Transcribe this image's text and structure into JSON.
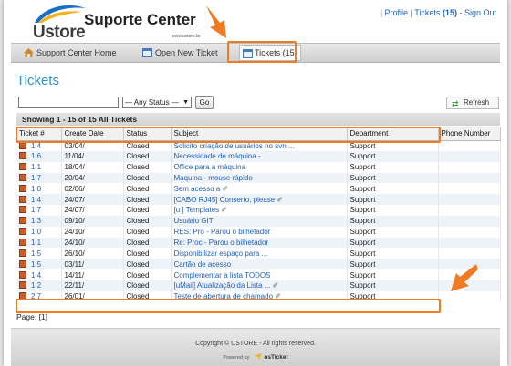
{
  "header": {
    "logo_text": "Ustore",
    "site_title": "Suporte Center",
    "site_url": "www.ustore.br",
    "links": {
      "sep1": "|",
      "profile": "Profile",
      "sep2": "|",
      "tickets_prefix": "Tickets ",
      "tickets_count": "(15)",
      "sep3": " - ",
      "sign_out": "Sign Out"
    }
  },
  "nav": {
    "items": [
      {
        "label": "Support Center Home",
        "icon": "home-icon"
      },
      {
        "label": "Open New Ticket",
        "icon": "new-ticket-icon"
      },
      {
        "label": "Tickets (15)",
        "icon": "tickets-icon",
        "active": true
      }
    ]
  },
  "main": {
    "title": "Tickets",
    "search": {
      "value": "",
      "placeholder": ""
    },
    "status_select": {
      "selected": "— Any Status —",
      "arrow": "▼"
    },
    "go_label": "Go",
    "refresh_label": "Refresh",
    "showing": "Showing  1 - 15 of 15 All Tickets",
    "columns": [
      "Ticket #",
      "Create Date",
      "Status",
      "Subject",
      "Department",
      "Phone Number"
    ],
    "rows": [
      {
        "num": "1   4",
        "date": "03/04/",
        "status": "Closed",
        "subject": "Solicito criação de usuários no svn ...",
        "dept": "Support",
        "attach": false
      },
      {
        "num": "1   6",
        "date": "11/04/",
        "status": "Closed",
        "subject": "Necessidade de máquina -",
        "dept": "Support",
        "attach": false
      },
      {
        "num": "1   1",
        "date": "18/04/",
        "status": "Closed",
        "subject": "Office para a máquina",
        "dept": "Support",
        "attach": false
      },
      {
        "num": "1   7",
        "date": "20/04/",
        "status": "Closed",
        "subject": "Maquina           - mouse rápido",
        "dept": "Support",
        "attach": false
      },
      {
        "num": "1   0",
        "date": "02/06/",
        "status": "Closed",
        "subject": "Sem acesso a",
        "dept": "Support",
        "attach": true
      },
      {
        "num": "1   4",
        "date": "24/07/",
        "status": "Closed",
        "subject": "[CABO RJ45] Conserto, please",
        "dept": "Support",
        "attach": true
      },
      {
        "num": "1   7",
        "date": "24/07/",
        "status": "Closed",
        "subject": "[u         ] Templates",
        "dept": "Support",
        "attach": true
      },
      {
        "num": "1   3",
        "date": "09/10/",
        "status": "Closed",
        "subject": "Usuário GIT",
        "dept": "Support",
        "attach": false
      },
      {
        "num": "1   0",
        "date": "24/10/",
        "status": "Closed",
        "subject": "RES: Pro         - Parou o bilhetador",
        "dept": "Support",
        "attach": false
      },
      {
        "num": "1   1",
        "date": "24/10/",
        "status": "Closed",
        "subject": "Re: Proc         - Parou o bilhetador",
        "dept": "Support",
        "attach": false
      },
      {
        "num": "1   5",
        "date": "26/10/",
        "status": "Closed",
        "subject": "Disponibilizar espaço para ...",
        "dept": "Support",
        "attach": false
      },
      {
        "num": "1   5",
        "date": "03/11/",
        "status": "Closed",
        "subject": "Cartão de acesso",
        "dept": "Support",
        "attach": false
      },
      {
        "num": "1   4",
        "date": "14/11/",
        "status": "Closed",
        "subject": "Complementar a lista TODOS",
        "dept": "Support",
        "attach": false
      },
      {
        "num": "1   2",
        "date": "22/11/",
        "status": "Closed",
        "subject": "[uMail] Atualização da Lista ...",
        "dept": "Support",
        "attach": true
      },
      {
        "num": "2   7",
        "date": "26/01/",
        "status": "Closed",
        "subject": "Teste de abertura de chamado",
        "dept": "Support",
        "attach": true
      }
    ],
    "pager": "Page: [1]"
  },
  "footer": {
    "copyright": "Copyright ©          USTORE - All rights reserved.",
    "powered_prefix": "Powered by",
    "powered_brand": "osTicket"
  },
  "colors": {
    "accent": "#f07b22",
    "link": "#1f5fb8",
    "title": "#2f8fcf"
  }
}
